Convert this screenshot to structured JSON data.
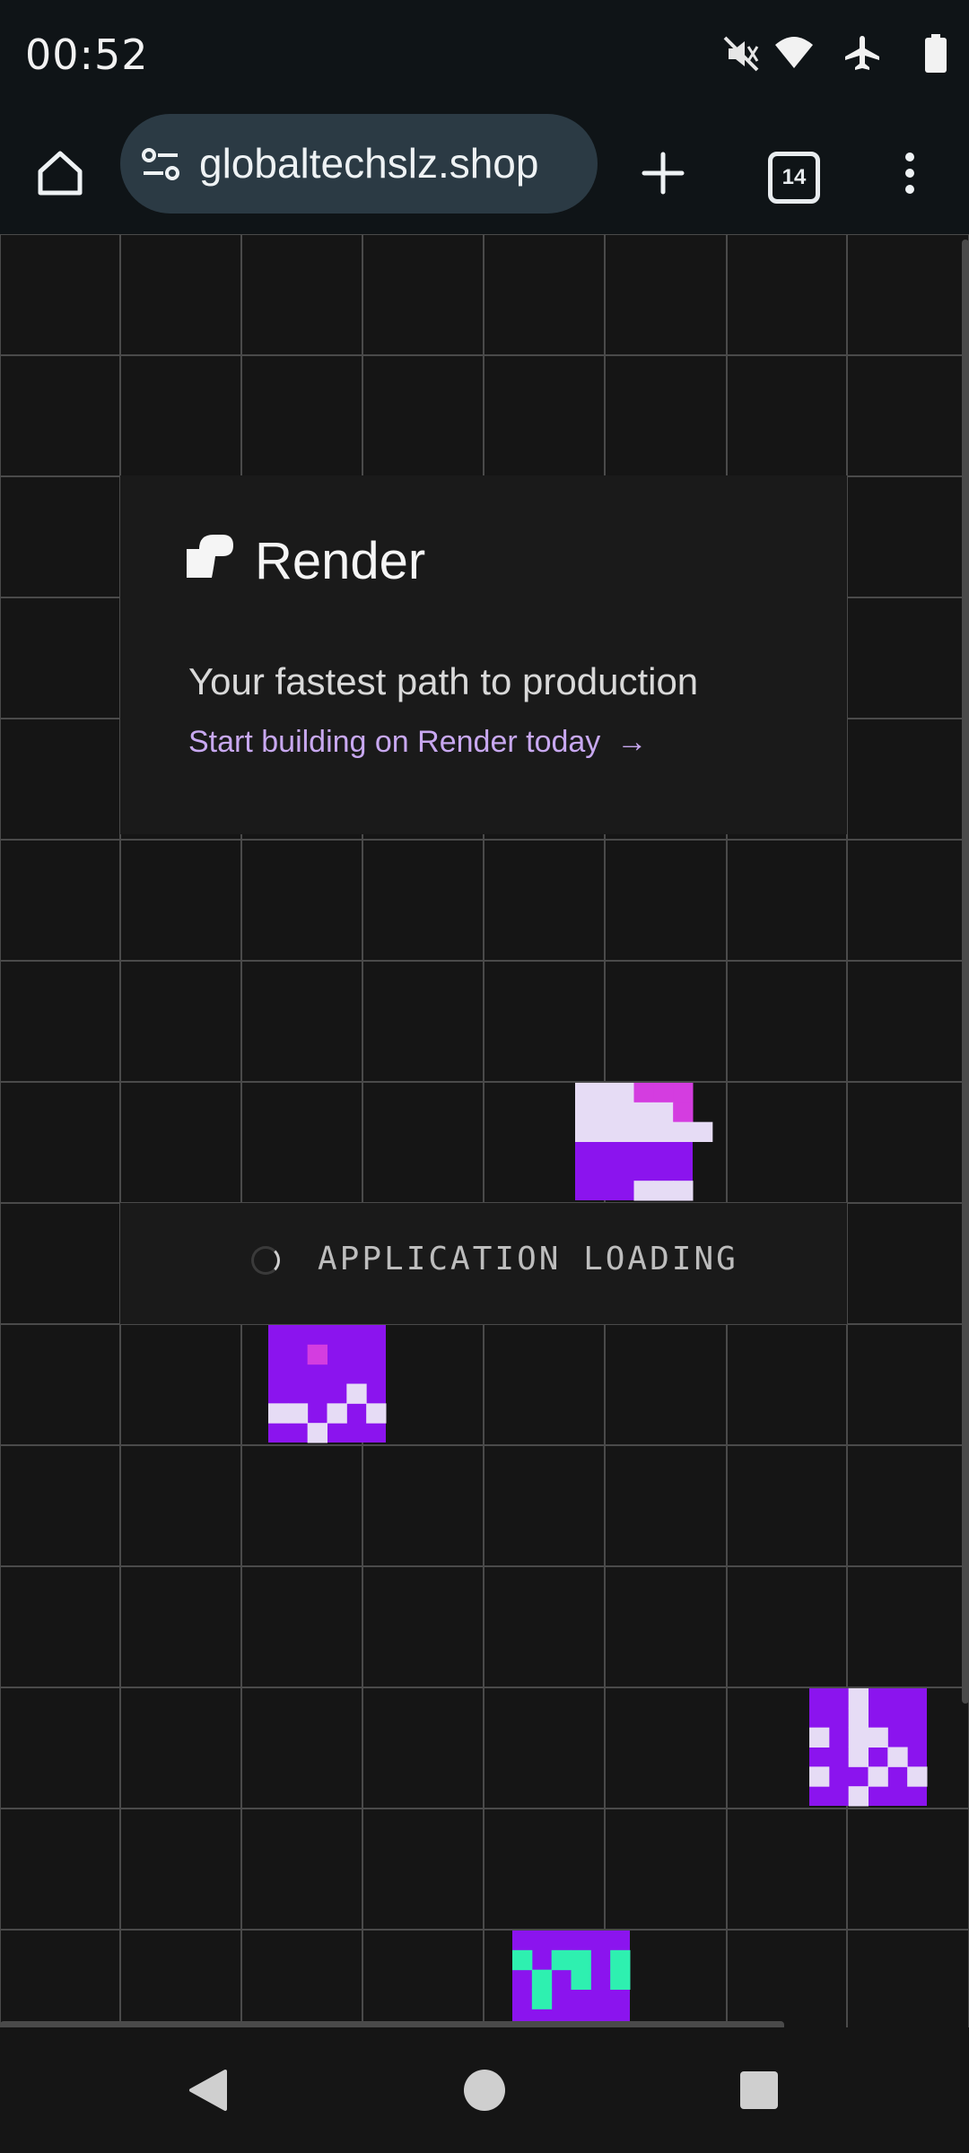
{
  "status_bar": {
    "time": "00:52",
    "icons": [
      "mute-vibrate-icon",
      "wifi-icon",
      "airplane-icon",
      "battery-icon"
    ]
  },
  "browser": {
    "url": "globaltechslz.shop",
    "tab_count": "14",
    "icons": [
      "home-icon",
      "site-settings-icon",
      "new-tab-icon",
      "tabs-icon",
      "more-menu-icon"
    ]
  },
  "hero": {
    "brand": "Render",
    "tagline": "Your fastest path to production",
    "cta_label": "Start building on Render today",
    "cta_arrow": "→"
  },
  "loading": {
    "label": "APPLICATION LOADING"
  },
  "colors": {
    "background": "#151515",
    "grid_line": "#4a4a4a",
    "card": "#1a1a1a",
    "accent_purple": "#8b14ee",
    "link": "#c8a8f0",
    "pixel_light": "#e6dcf5",
    "pixel_pink": "#d43de0",
    "pixel_green": "#2ef0b0"
  },
  "navigation_bar": {
    "icons": [
      "back-icon",
      "home-circle-icon",
      "recents-icon"
    ]
  }
}
